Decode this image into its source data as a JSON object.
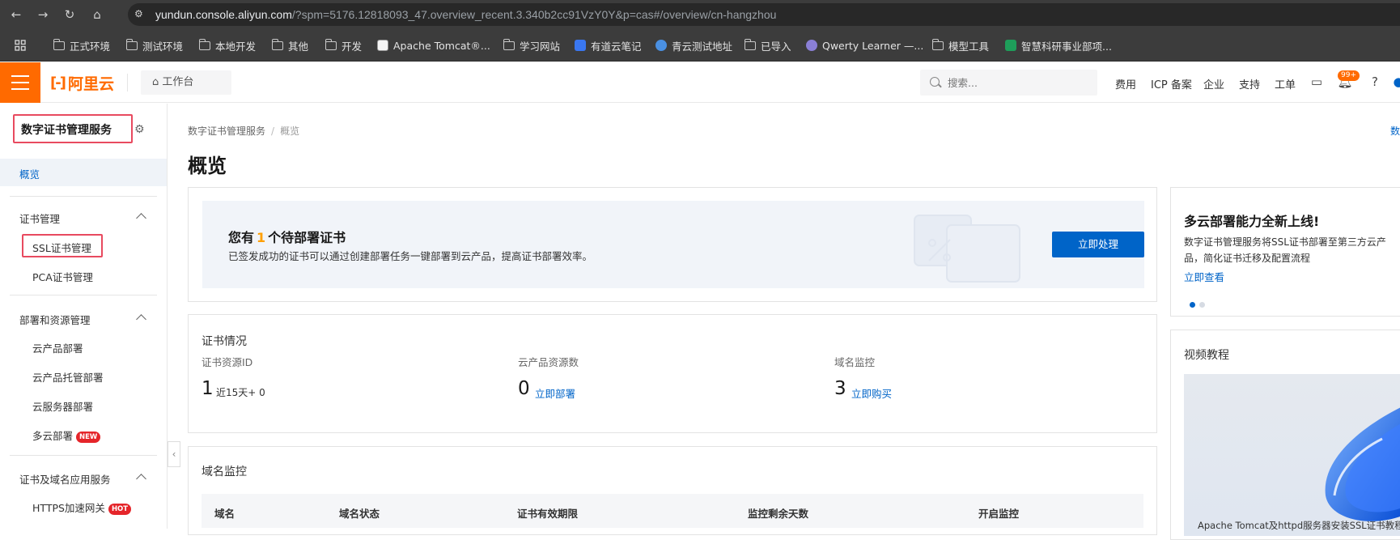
{
  "browser": {
    "url_host": "yundun.console.aliyun.com",
    "url_rest": "/?spm=5176.12818093_47.overview_recent.3.340b2cc91VzY0Y&p=cas#/overview/cn-hangzhou",
    "bookmarks": [
      "正式环境",
      "测试环境",
      "本地开发",
      "其他",
      "开发",
      "Apache Tomcat®...",
      "学习网站",
      "有道云笔记",
      "青云测试地址",
      "已导入",
      "Qwerty Learner —...",
      "模型工具",
      "智慧科研事业部项..."
    ]
  },
  "topbar": {
    "logo_text": "阿里云",
    "workbench": "工作台",
    "search_placeholder": "搜索...",
    "links": [
      "费用",
      "ICP 备案",
      "企业",
      "支持",
      "工单"
    ],
    "notification_badge": "99+"
  },
  "sidebar": {
    "title": "数字证书管理服务",
    "active_item": "概览",
    "groups": [
      {
        "label": "证书管理",
        "items": [
          "SSL证书管理",
          "PCA证书管理"
        ]
      },
      {
        "label": "部署和资源管理",
        "items": [
          "云产品部署",
          "云产品托管部署",
          "云服务器部署",
          "多云部署"
        ]
      },
      {
        "label": "证书及域名应用服务",
        "items": [
          "HTTPS加速网关"
        ]
      }
    ],
    "tag_new": "NEW",
    "tag_hot": "HOT"
  },
  "main": {
    "breadcrumb": [
      "数字证书管理服务",
      "概览"
    ],
    "title": "概览",
    "edge_link": "数",
    "banner": {
      "title_pre": "您有",
      "title_num": "1",
      "title_post": "个待部署证书",
      "desc": "已签发成功的证书可以通过创建部署任务一键部署到云产品，提高证书部署效率。",
      "button": "立即处理"
    },
    "cert_status": {
      "title": "证书情况",
      "stats": [
        {
          "label": "证书资源ID",
          "value": "1",
          "sub": "近15天+ 0"
        },
        {
          "label": "云产品资源数",
          "value": "0",
          "link": "立即部署"
        },
        {
          "label": "域名监控",
          "value": "3",
          "link": "立即购买"
        }
      ]
    },
    "domain_monitor": {
      "title": "域名监控",
      "columns": [
        "域名",
        "域名状态",
        "证书有效期限",
        "监控剩余天数",
        "开启监控"
      ]
    }
  },
  "right": {
    "promo": {
      "title": "多云部署能力全新上线!",
      "desc": "数字证书管理服务将SSL证书部署至第三方云产品，简化证书迁移及配置流程",
      "link": "立即查看"
    },
    "video": {
      "title": "视频教程",
      "caption": "Apache Tomcat及httpd服务器安装SSL证书教程"
    }
  },
  "colors": {
    "brand": "#ff6a00",
    "primary": "#0064c8",
    "highlight_box": "#e84a5f",
    "hot": "#e5252a",
    "new": "#e5252a"
  }
}
